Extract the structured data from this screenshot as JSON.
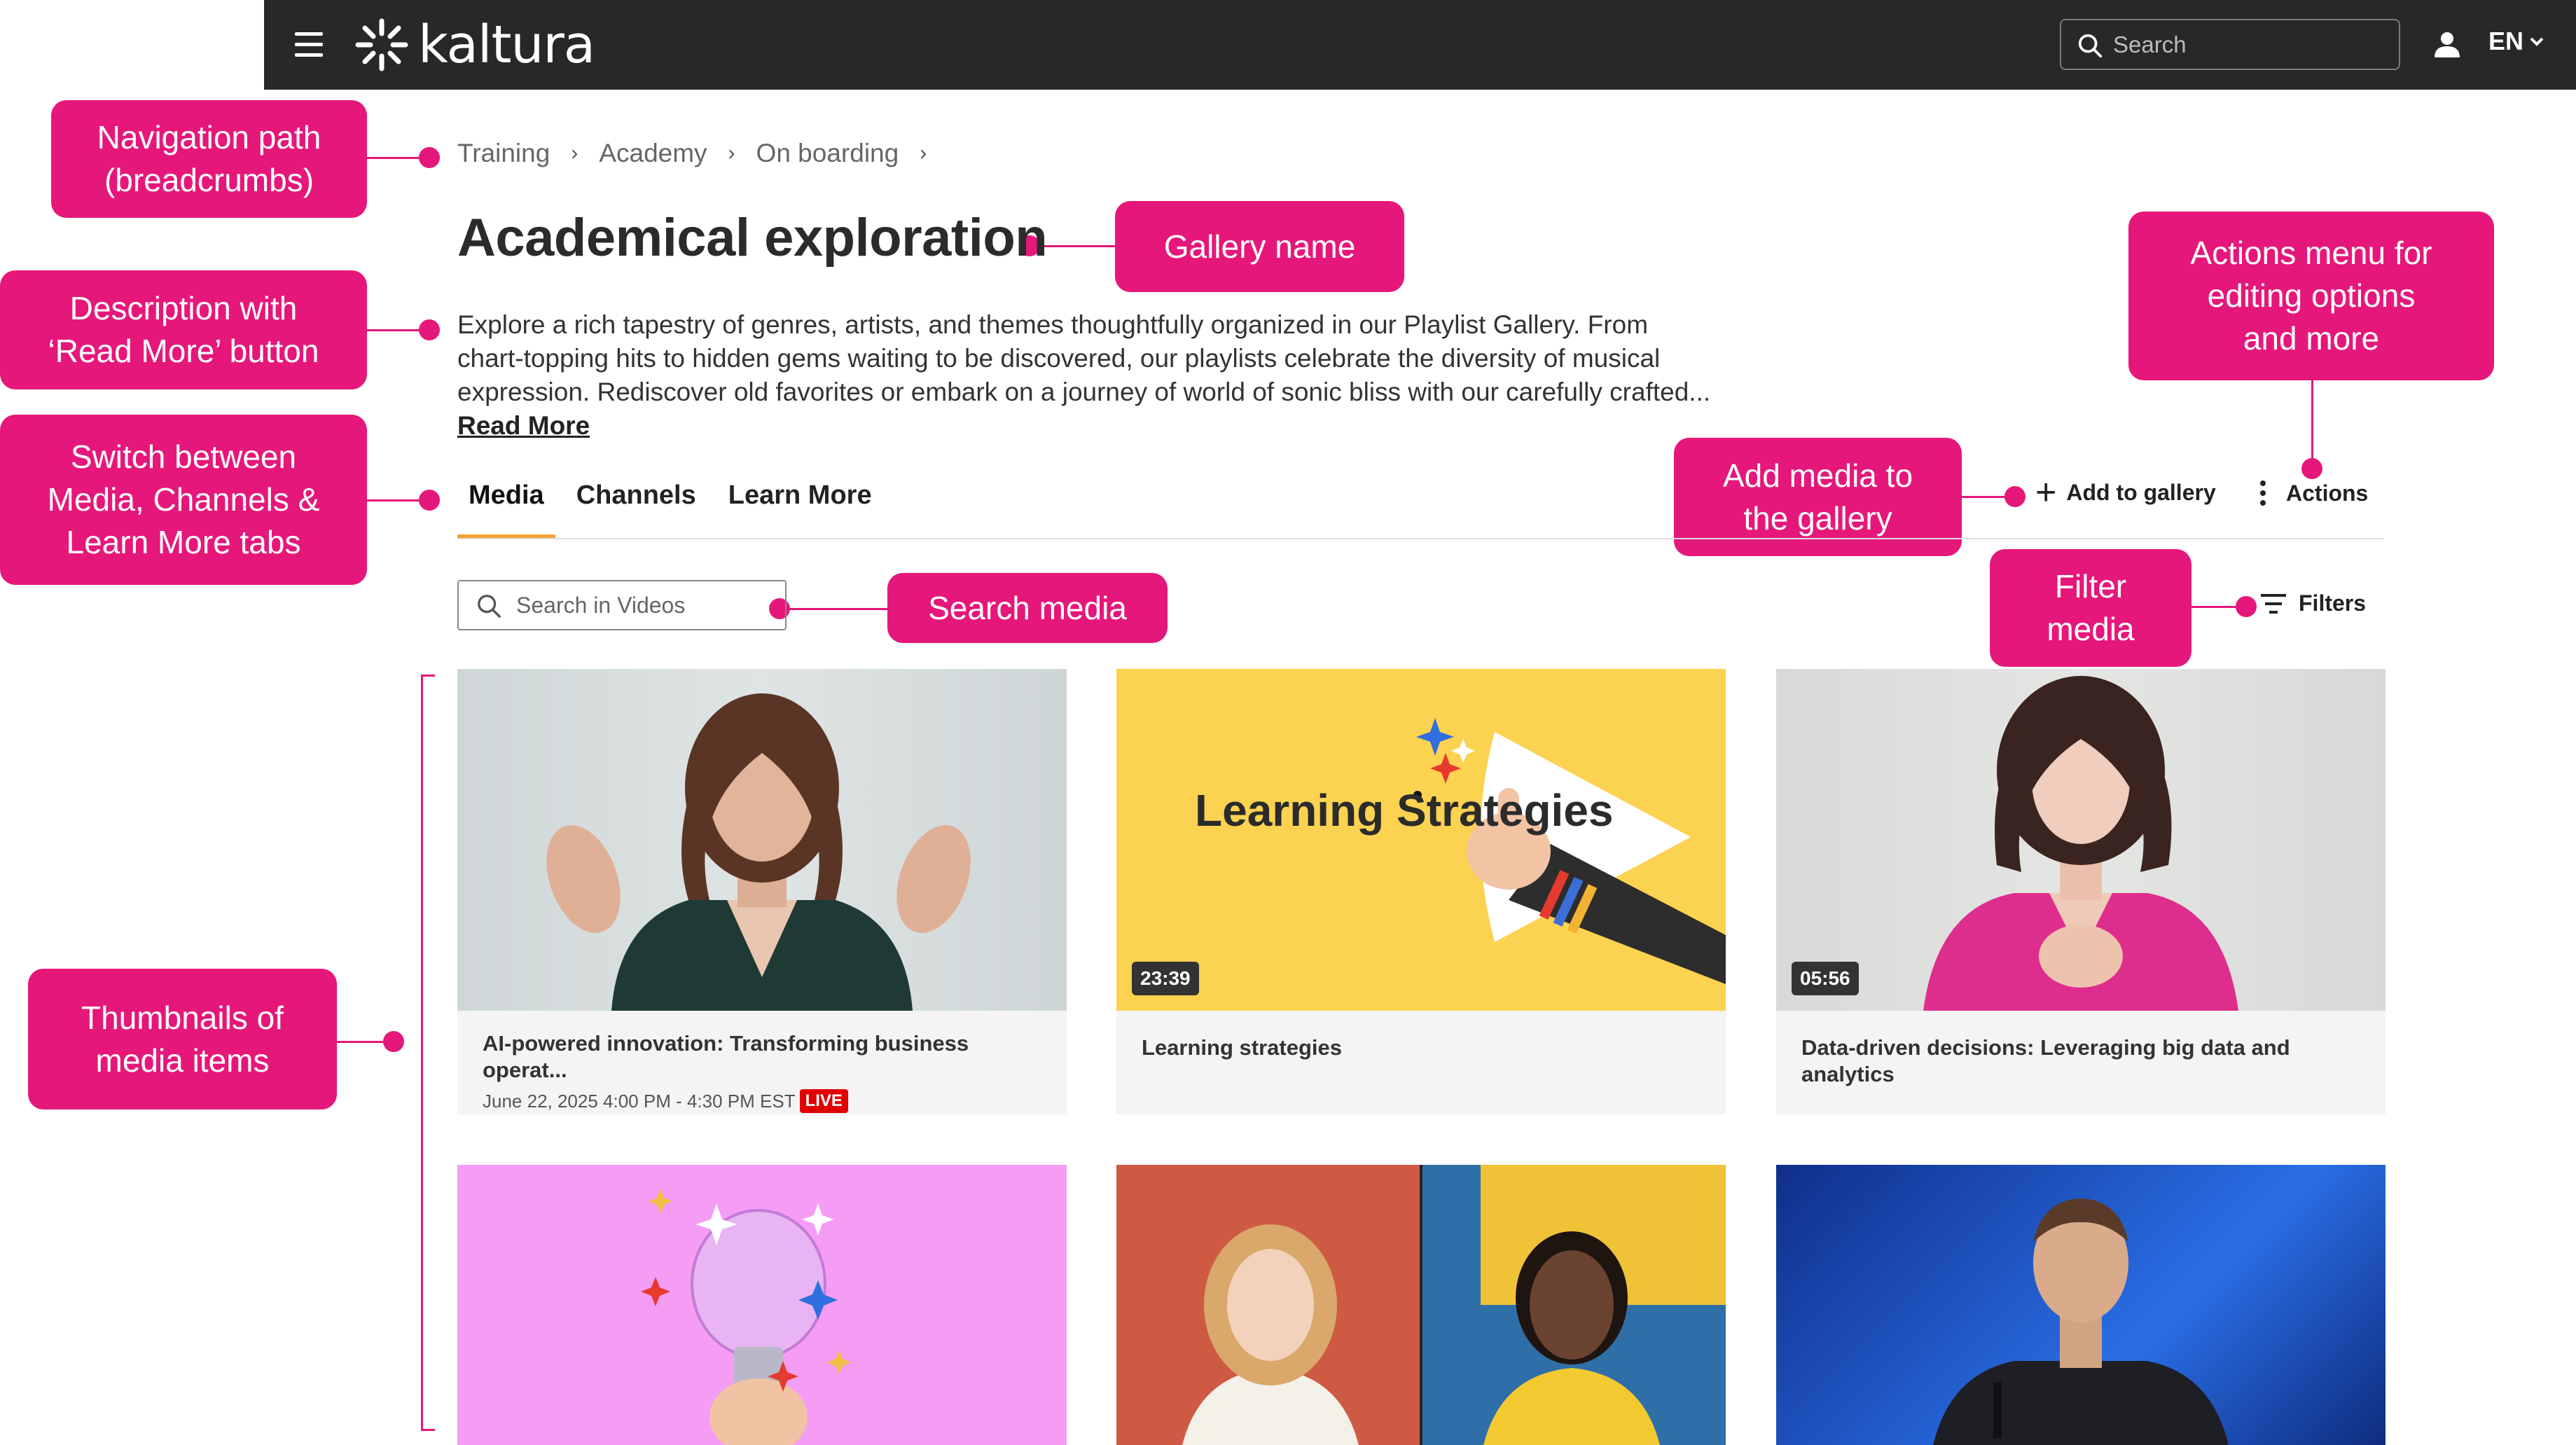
{
  "topbar": {
    "logo_text": "kaltura",
    "search_placeholder": "Search",
    "language": "EN"
  },
  "colors": {
    "callout": "#e6177a",
    "topbar": "#282828",
    "tab_underline": "#f3a233",
    "live_badge": "#e00000"
  },
  "callouts": {
    "breadcrumbs": "Navigation path\n(breadcrumbs)",
    "gallery_name": "Gallery name",
    "description": "Description with\n‘Read More’ button",
    "actions_menu": "Actions menu for\nediting options\nand more",
    "tabs": "Switch between\nMedia, Channels &\nLearn More tabs",
    "add_media": "Add media to\nthe gallery",
    "search_media": "Search media",
    "filter_media": "Filter\nmedia",
    "thumbnails": "Thumbnails of\nmedia items"
  },
  "breadcrumb": [
    "Training",
    "Academy",
    "On boarding"
  ],
  "gallery": {
    "title": "Academical exploration",
    "description": "Explore a rich tapestry of genres, artists, and themes thoughtfully organized in our Playlist Gallery. From chart-topping hits to hidden gems waiting to be discovered, our playlists celebrate the diversity of musical expression. Rediscover old favorites or embark on a journey of world of sonic bliss with our carefully crafted...",
    "read_more": "Read More"
  },
  "tabs": [
    "Media",
    "Channels",
    "Learn More"
  ],
  "toolbar": {
    "add_to_gallery": "Add to gallery",
    "actions": "Actions",
    "search_placeholder": "Search in Videos",
    "filters": "Filters"
  },
  "media": [
    {
      "title": "AI-powered innovation: Transforming business operat...",
      "date": "June 22, 2025 4:00 PM - 4:30 PM EST",
      "badge": "LIVE"
    },
    {
      "title": "Learning strategies",
      "duration": "23:39",
      "thumb_text": "Learning Strategies"
    },
    {
      "title": "Data-driven decisions: Leveraging big data and analytics",
      "duration": "05:56"
    }
  ]
}
